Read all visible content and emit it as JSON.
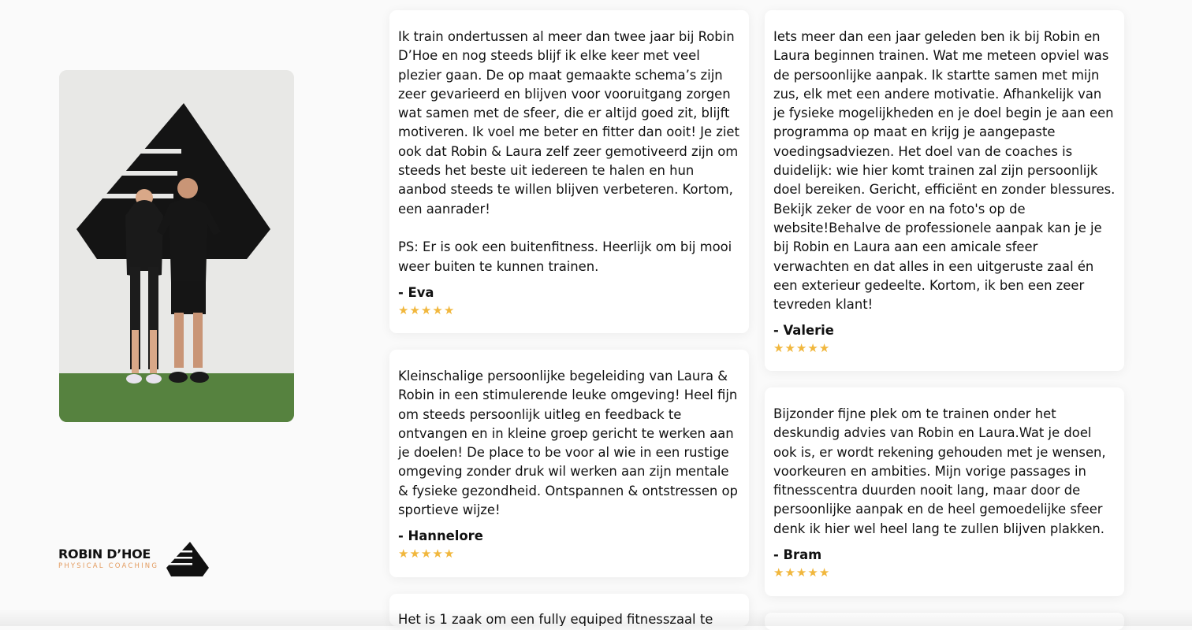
{
  "brand": {
    "name": "ROBIN D’HOE",
    "tagline": "PHYSICAL COACHING",
    "accent_color": "#e39b5f"
  },
  "photo": {
    "icon": "team-photo"
  },
  "star_color": "#f1b73d",
  "reviews": [
    {
      "text": "Ik train ondertussen al meer dan twee jaar bij Robin D’Hoe en nog steeds blijf ik elke keer met veel plezier gaan. De op maat gemaakte schema’s zijn zeer gevarieerd en blijven voor vooruitgang zorgen wat samen met de sfeer, die er altijd goed zit, blijft motiveren. Ik voel me beter en fitter dan ooit! Je ziet ook dat Robin & Laura zelf zeer gemotiveerd zijn om steeds het beste uit iedereen te halen en hun aanbod steeds te willen blijven verbeteren. Kortom, een aanrader!\n\nPS: Er is ook een buitenfitness. Heerlijk om bij mooi weer buiten te kunnen trainen.",
      "author": "- Eva",
      "rating": 5
    },
    {
      "text": "Iets meer dan een jaar geleden ben ik bij Robin en Laura beginnen trainen. Wat me meteen opviel was de persoonlijke aanpak. Ik startte samen met mijn zus, elk met een andere motivatie. Afhankelijk van je fysieke mogelijkheden en je doel begin je aan een programma op maat en krijg je aangepaste voedingsadviezen. Het doel van de coaches is duidelijk: wie hier komt trainen zal zijn persoonlijk doel bereiken. Gericht, efficiënt  en zonder blessures. Bekijk zeker de voor en na foto's op de website!Behalve de professionele aanpak kan je je bij Robin en Laura aan een amicale sfeer verwachten en dat alles in een uitgeruste zaal én een exterieur gedeelte. Kortom, ik ben een zeer tevreden klant!",
      "author": "- Valerie",
      "rating": 5
    },
    {
      "text": "Kleinschalige persoonlijke begeleiding van Laura & Robin in een stimulerende leuke omgeving! Heel fijn om steeds persoonlijk uitleg en feedback te ontvangen en in kleine groep gericht te werken aan je doelen! De place to be voor al wie in een rustige omgeving zonder druk wil werken aan zijn mentale & fysieke gezondheid. Ontspannen & ontstressen op sportieve wijze!",
      "author": "- Hannelore",
      "rating": 5
    },
    {
      "text": "Bijzonder fijne plek om te trainen onder het deskundig advies van Robin en Laura.Wat je doel ook is, er wordt rekening gehouden met je wensen, voorkeuren en ambities. Mijn vorige passages in fitnesscentra duurden nooit lang, maar door de persoonlijke aanpak en de heel gemoedelijke sfeer denk ik hier wel heel lang te zullen blijven plakken.",
      "author": "- Bram",
      "rating": 5
    },
    {
      "text": "Het is 1 zaak om een fully equiped fitnesszaal te",
      "author": "",
      "rating": 0
    }
  ]
}
